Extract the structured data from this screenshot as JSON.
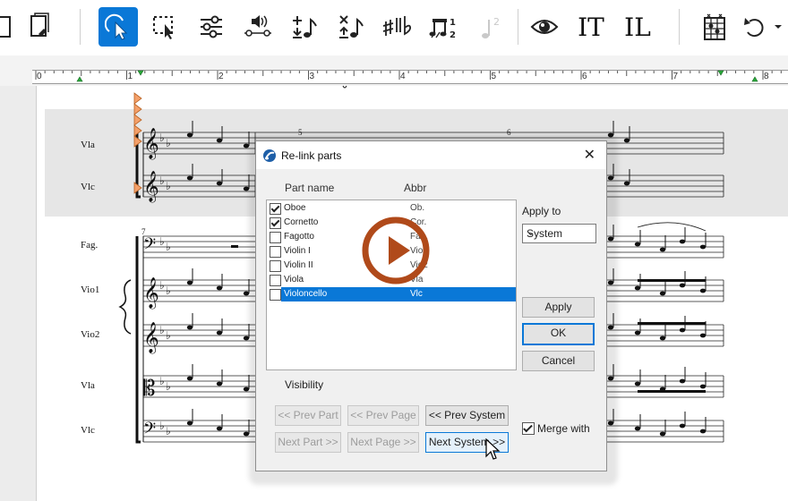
{
  "toolbar": {
    "icons": [
      "document-icon",
      "select-icon",
      "marquee-select-icon",
      "mixer-icon",
      "playback-volume-icon",
      "add-note-icon",
      "delete-note-icon",
      "accidentals-icon",
      "tuplet-icon",
      "disabled-note-icon",
      "eye-icon",
      "insert-text-icon",
      "insert-lyric-icon",
      "chord-diagram-icon",
      "undo-icon",
      "dropdown-icon"
    ],
    "text_tool": "IT",
    "lyric_tool": "IL",
    "tuplet_number": "2",
    "accent": "#0a78d7"
  },
  "ruler": {
    "labels": [
      "0",
      "1",
      "2",
      "3",
      "4",
      "5",
      "6",
      "7",
      "8"
    ]
  },
  "score": {
    "measure_numbers": [
      "5",
      "6",
      "7"
    ],
    "top_system_instruments": [
      "Vla",
      "Vlc"
    ],
    "bottom_system_instruments": [
      "Fag.",
      "Vio1",
      "Vio2",
      "Vla",
      "Vlc"
    ]
  },
  "dialog": {
    "title": "Re-link parts",
    "col_part_name": "Part name",
    "col_abbr": "Abbr",
    "parts": [
      {
        "name": "Oboe",
        "abbr": "Ob.",
        "checked": true,
        "selected": false
      },
      {
        "name": "Cornetto",
        "abbr": "Cor.",
        "checked": true,
        "selected": false
      },
      {
        "name": "Fagotto",
        "abbr": "Fag.",
        "checked": false,
        "selected": false
      },
      {
        "name": "Violin I",
        "abbr": "Vio1",
        "checked": false,
        "selected": false
      },
      {
        "name": "Violin II",
        "abbr": "Vio2",
        "checked": false,
        "selected": false
      },
      {
        "name": "Viola",
        "abbr": "Vla",
        "checked": false,
        "selected": false
      },
      {
        "name": "Violoncello",
        "abbr": "Vlc",
        "checked": false,
        "selected": true
      }
    ],
    "apply_to_label": "Apply to",
    "apply_to_value": "System",
    "apply_button": "Apply",
    "ok_button": "OK",
    "cancel_button": "Cancel",
    "visibility_label": "Visibility",
    "prev_part": "<< Prev Part",
    "prev_page": "<< Prev Page",
    "prev_system": "<< Prev System",
    "next_part": "Next Part >>",
    "next_page": "Next Page >>",
    "next_system": "Next System >>",
    "merge_with_label": "Merge with",
    "merge_with_checked": true
  },
  "overlay": {
    "play_button_color": "#b04a1a"
  }
}
